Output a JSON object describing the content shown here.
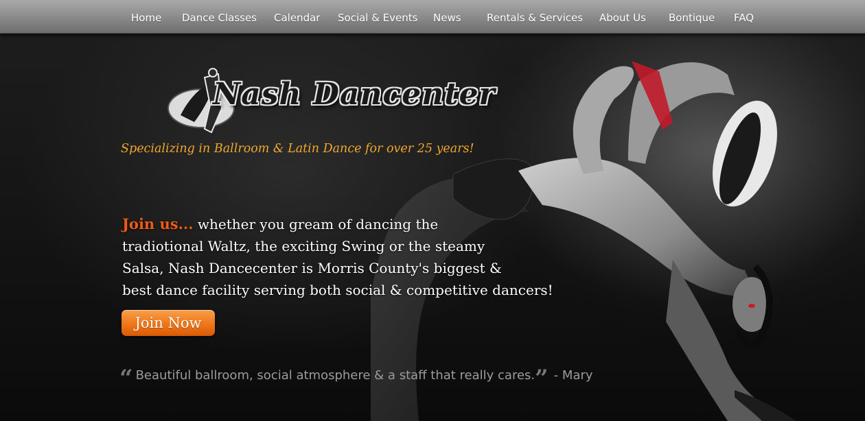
{
  "nav": {
    "items": [
      {
        "label": "Home"
      },
      {
        "label": "Dance Classes"
      },
      {
        "label": "Calendar"
      },
      {
        "label": "Social & Events"
      },
      {
        "label": "News"
      },
      {
        "label": "Rentals & Services"
      },
      {
        "label": "About Us"
      },
      {
        "label": "Bontique"
      },
      {
        "label": "FAQ"
      }
    ]
  },
  "hero": {
    "logo_text": "Nash Dancenter",
    "tagline": "Specializing in Ballroom & Latin Dance for over 25 years!",
    "intro_lead": "Join us...",
    "intro_lines": [
      " whether you gream of dancing the",
      "tradiotional Waltz, the exciting Swing or the steamy",
      "Salsa, Nash Dancecenter is Morris County's biggest &",
      "best dance facility serving both social & competitive dancers!"
    ],
    "join_button": "Join Now",
    "quote": {
      "open_mark": "“",
      "text": "Beautiful ballroom, social atmosphere & a staff that really cares.",
      "close_mark": "”",
      "author": "- Mary"
    }
  },
  "colors": {
    "accent_orange": "#f05a14",
    "tagline_gold": "#f2a72e",
    "button_orange": "#f07a1c",
    "nav_gray": "#8f8f8f"
  },
  "icons": {
    "logo_emblem": "dancing-couple-icon"
  }
}
